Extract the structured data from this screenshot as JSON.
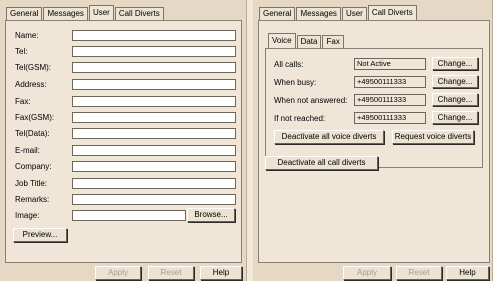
{
  "left": {
    "tabs": [
      "General",
      "Messages",
      "User",
      "Call Diverts"
    ],
    "active_tab": "User",
    "fields": [
      {
        "label": "Name:",
        "value": ""
      },
      {
        "label": "Tel:",
        "value": ""
      },
      {
        "label": "Tel(GSM):",
        "value": ""
      },
      {
        "label": "Address:",
        "value": ""
      },
      {
        "label": "Fax:",
        "value": ""
      },
      {
        "label": "Fax(GSM):",
        "value": ""
      },
      {
        "label": "Tel(Data):",
        "value": ""
      },
      {
        "label": "E-mail:",
        "value": ""
      },
      {
        "label": "Company:",
        "value": ""
      },
      {
        "label": "Job Title:",
        "value": ""
      },
      {
        "label": "Remarks:",
        "value": ""
      },
      {
        "label": "Image:",
        "value": ""
      }
    ],
    "browse_label": "Browse...",
    "preview_label": "Preview...",
    "apply_label": "Apply",
    "reset_label": "Reset",
    "help_label": "Help"
  },
  "right": {
    "tabs": [
      "General",
      "Messages",
      "User",
      "Call Diverts"
    ],
    "active_tab": "Call Diverts",
    "inner_tabs": [
      "Voice",
      "Data",
      "Fax"
    ],
    "active_inner_tab": "Voice",
    "diverts": [
      {
        "label": "All calls:",
        "value": "Not Active",
        "button": "Change..."
      },
      {
        "label": "When busy:",
        "value": "+49500111333",
        "button": "Change..."
      },
      {
        "label": "When not answered:",
        "value": "+49500111333",
        "button": "Change..."
      },
      {
        "label": "If not reached:",
        "value": "+49500111333",
        "button": "Change..."
      }
    ],
    "deactivate_voice_label": "Deactivate all voice diverts",
    "request_voice_label": "Request voice diverts",
    "deactivate_all_label": "Deactivate all call diverts",
    "apply_label": "Apply",
    "reset_label": "Reset",
    "help_label": "Help"
  }
}
